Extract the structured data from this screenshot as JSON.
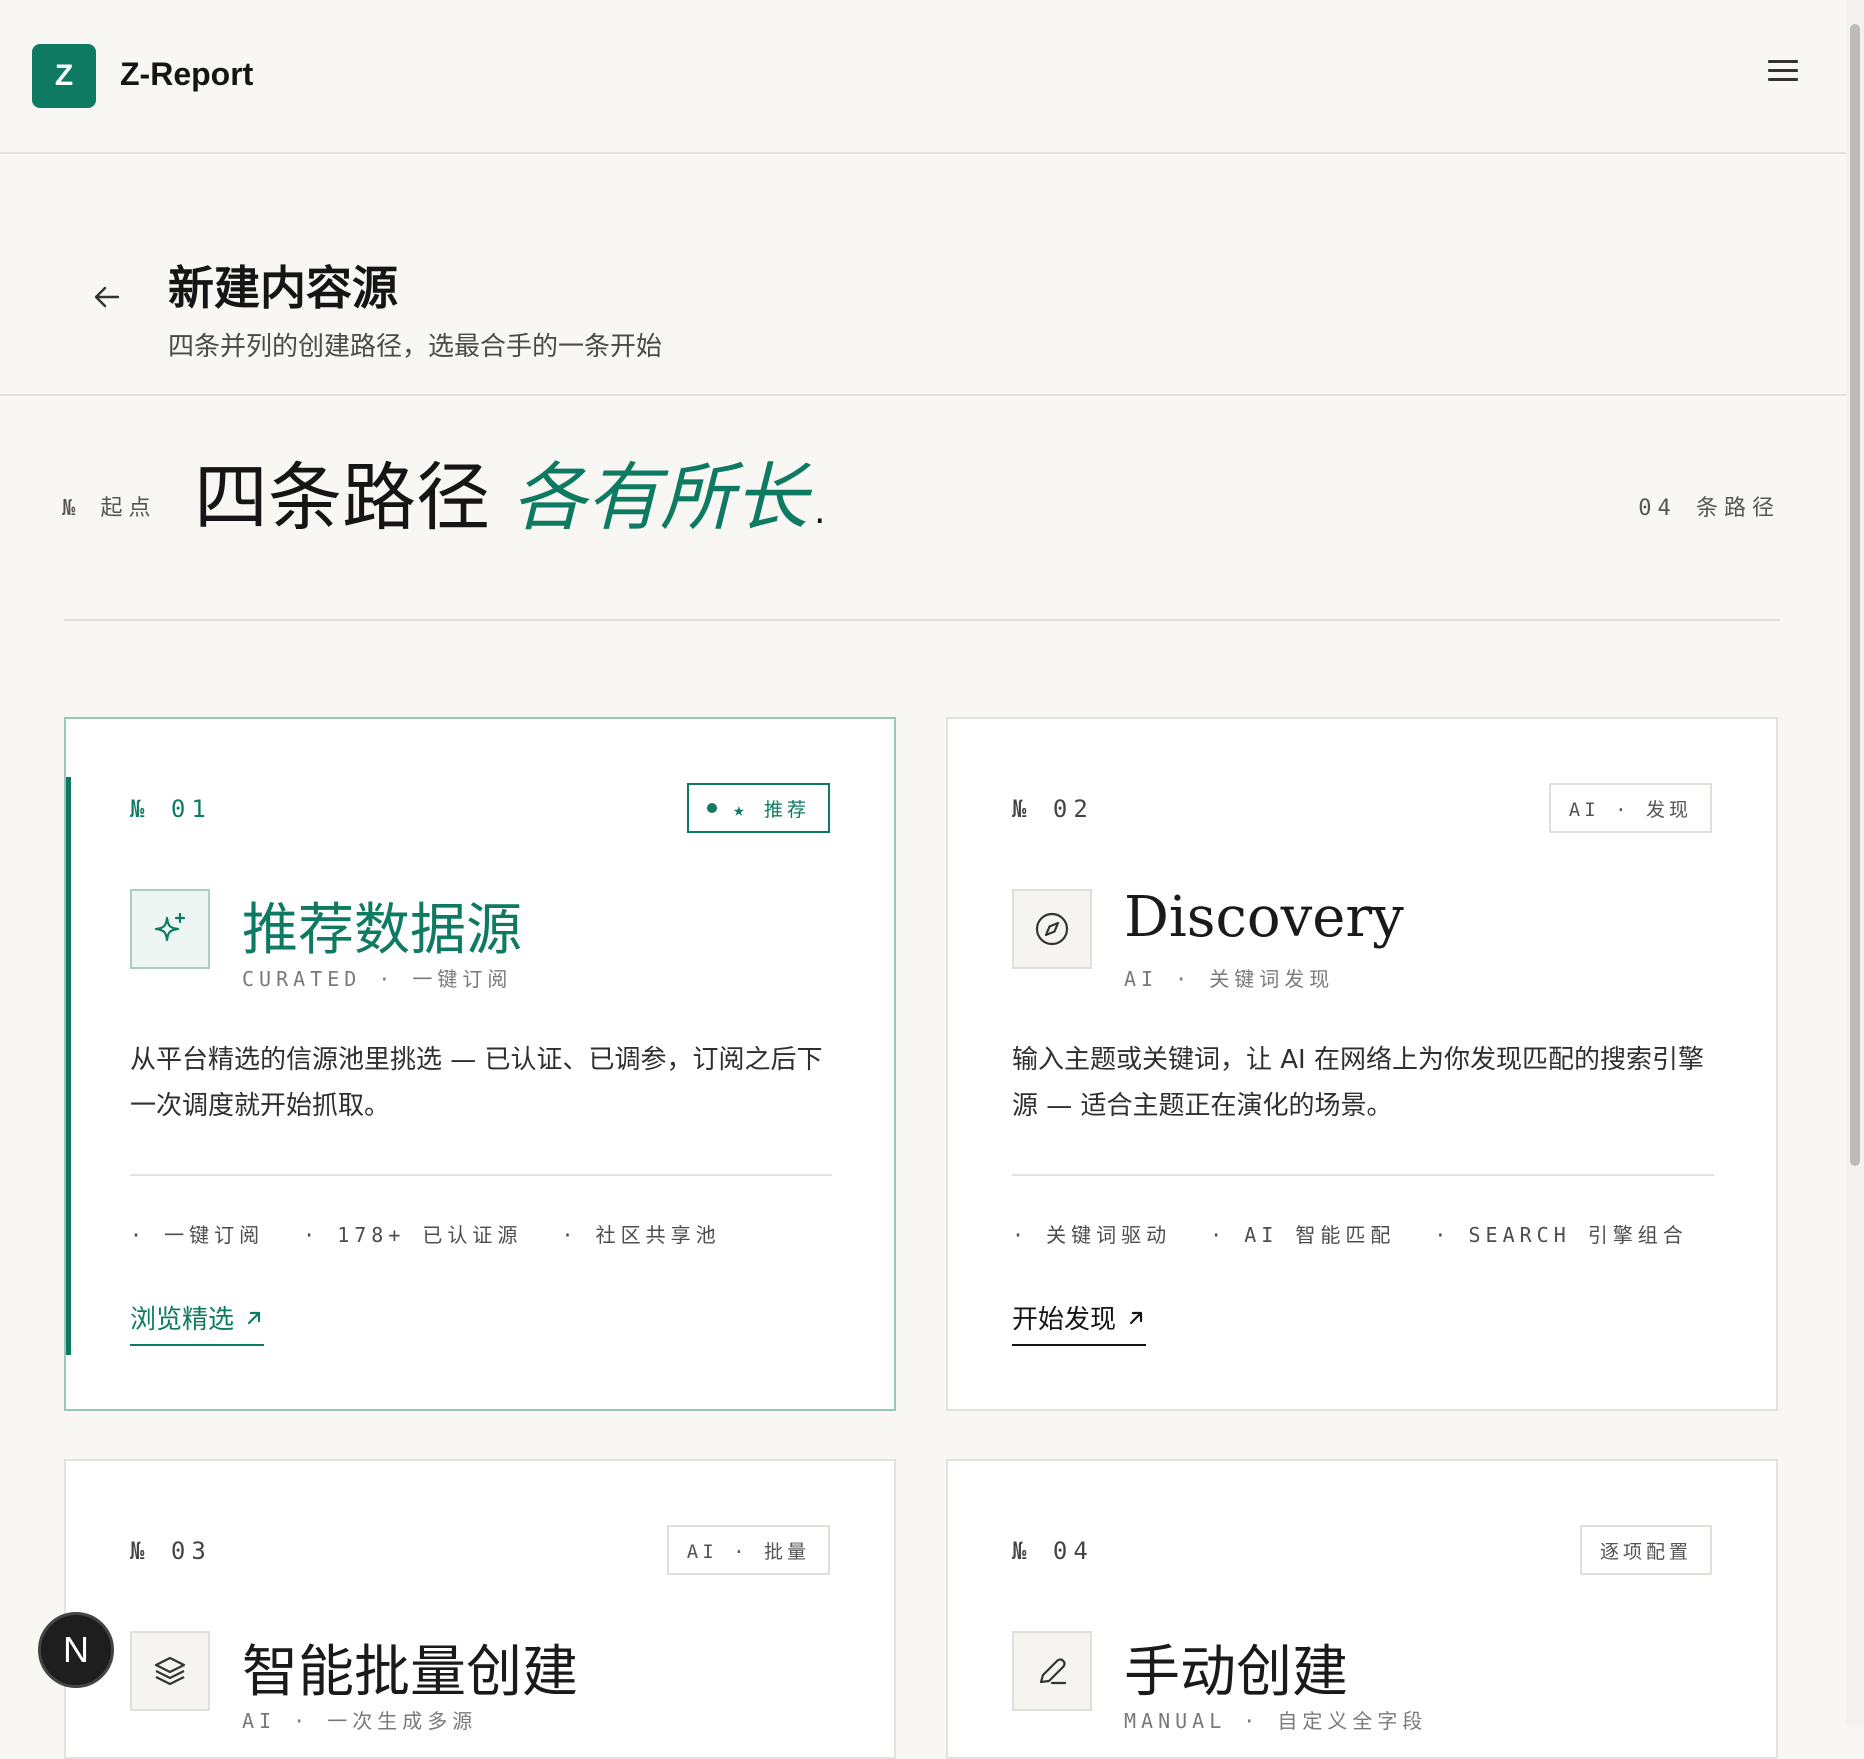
{
  "app": {
    "logo_letter": "Z",
    "name": "Z-Report"
  },
  "header": {
    "title": "新建内容源",
    "subtitle": "四条并列的创建路径，选最合手的一条开始"
  },
  "hero": {
    "section_label": "№ 起点",
    "title_main": "四条路径",
    "title_accent": "各有所长",
    "title_end": ".",
    "count_label": "04 条路径"
  },
  "cards": [
    {
      "no": "№ 01",
      "badge": "★ 推荐",
      "title": "推荐数据源",
      "sub": "CURATED · 一键订阅",
      "desc": "从平台精选的信源池里挑选 — 已认证、已调参，订阅之后下一次调度就开始抓取。",
      "features": [
        "· 一键订阅",
        "· 178+ 已认证源",
        "· 社区共享池"
      ],
      "cta": "浏览精选"
    },
    {
      "no": "№ 02",
      "badge": "AI · 发现",
      "title": "Discovery",
      "sub": "AI · 关键词发现",
      "desc": "输入主题或关键词，让 AI 在网络上为你发现匹配的搜索引擎源 — 适合主题正在演化的场景。",
      "features": [
        "· 关键词驱动",
        "· AI 智能匹配",
        "· SEARCH 引擎组合"
      ],
      "cta": "开始发现"
    },
    {
      "no": "№ 03",
      "badge": "AI · 批量",
      "title": "智能批量创建",
      "sub": "AI · 一次生成多源"
    },
    {
      "no": "№ 04",
      "badge": "逐项配置",
      "title": "手动创建",
      "sub": "MANUAL · 自定义全字段"
    }
  ],
  "fab": {
    "label": "N"
  },
  "colors": {
    "accent": "#0e7a62",
    "background": "#f8f7f4"
  }
}
